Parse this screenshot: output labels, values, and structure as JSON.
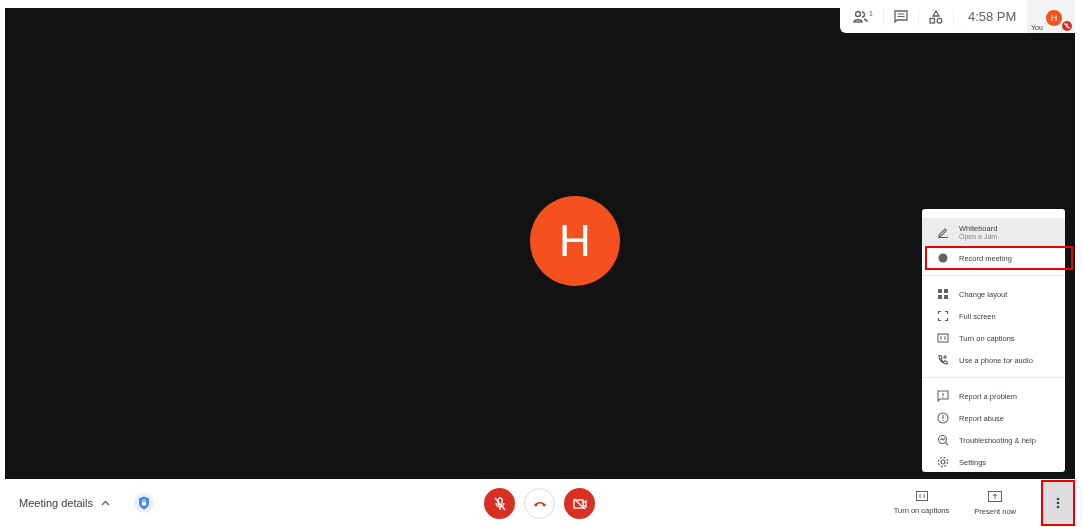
{
  "top_bar": {
    "participant_count": "1",
    "time": "4:58 PM",
    "self_label": "You",
    "self_initial": "H",
    "self_muted": true
  },
  "stage": {
    "initial": "H"
  },
  "menu": {
    "groups": [
      {
        "items": [
          {
            "kind": "pen",
            "label": "Whiteboard",
            "sublabel": "Open a Jam",
            "hovered": true,
            "highlighted": false
          },
          {
            "kind": "record",
            "label": "Record meeting",
            "hovered": false,
            "highlighted": true
          }
        ]
      },
      {
        "items": [
          {
            "kind": "layout",
            "label": "Change layout",
            "hovered": false,
            "highlighted": false
          },
          {
            "kind": "fullscreen",
            "label": "Full screen",
            "hovered": false,
            "highlighted": false
          },
          {
            "kind": "captions",
            "label": "Turn on captions",
            "hovered": false,
            "highlighted": false
          },
          {
            "kind": "phone",
            "label": "Use a phone for audio",
            "hovered": false,
            "highlighted": false
          }
        ]
      },
      {
        "items": [
          {
            "kind": "report",
            "label": "Report a problem",
            "hovered": false,
            "highlighted": false
          },
          {
            "kind": "abuse",
            "label": "Report abuse",
            "hovered": false,
            "highlighted": false
          },
          {
            "kind": "help",
            "label": "Troubleshooting & help",
            "hovered": false,
            "highlighted": false
          },
          {
            "kind": "settings",
            "label": "Settings",
            "hovered": false,
            "highlighted": false
          }
        ]
      }
    ]
  },
  "bottom_bar": {
    "meeting_details": "Meeting details",
    "mic_on": false,
    "camera_on": false,
    "actions": [
      {
        "kind": "captions",
        "label": "Turn on captions"
      },
      {
        "kind": "present",
        "label": "Present now"
      }
    ],
    "more_highlighted": true
  }
}
